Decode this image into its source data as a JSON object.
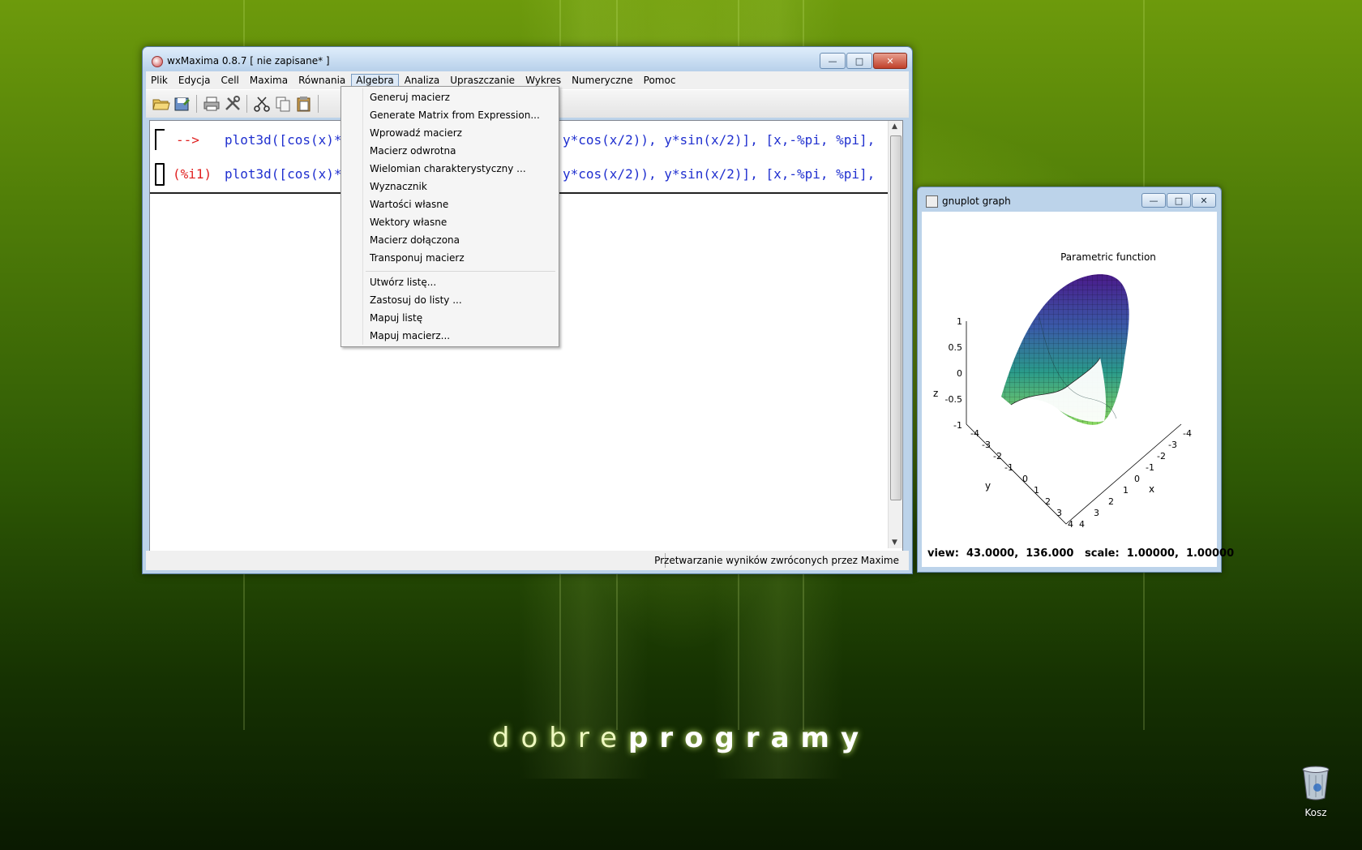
{
  "desktop": {
    "brand_light": "dobre",
    "brand_bold": "programy",
    "trash_label": "Kosz"
  },
  "wxmaxima": {
    "title": "wxMaxima 0.8.7 [ nie zapisane* ]",
    "menu": [
      "Plik",
      "Edycja",
      "Cell",
      "Maxima",
      "Równania",
      "Algebra",
      "Analiza",
      "Upraszczanie",
      "Wykres",
      "Numeryczne",
      "Pomoc"
    ],
    "active_menu": "Algebra",
    "cells": [
      {
        "prompt": "-->",
        "code_left": "plot3d([cos(x)*",
        "code_right": "y*cos(x/2)), y*sin(x/2)], [x,-%pi, %pi],"
      },
      {
        "prompt": "(%i1)",
        "code_left": "plot3d([cos(x)*",
        "code_right": "y*cos(x/2)), y*sin(x/2)], [x,-%pi, %pi],"
      }
    ],
    "status": "Przetwarzanie wyników zwróconych przez Maxime",
    "algebra_menu": {
      "group1": [
        "Generuj macierz",
        "Generate Matrix from Expression...",
        "Wprowadź macierz",
        "Macierz odwrotna",
        "Wielomian charakterystyczny ...",
        "Wyznacznik",
        "Wartości własne",
        "Wektory własne",
        "Macierz dołączona",
        "Transponuj macierz"
      ],
      "group2": [
        "Utwórz listę...",
        "Zastosuj do listy ...",
        "Mapuj listę",
        "Mapuj macierz..."
      ]
    }
  },
  "gnuplot": {
    "title": "gnuplot graph",
    "view_text": "view:  43.0000,  136.000   scale:  1.00000,  1.00000"
  },
  "chart_data": {
    "type": "surface3d",
    "title": "Parametric function",
    "xlabel": "x",
    "ylabel": "y",
    "zlabel": "z",
    "x_ticks": [
      "-4",
      "-3",
      "-2",
      "-1",
      "0",
      "1",
      "2",
      "3",
      "4"
    ],
    "y_ticks": [
      "-4",
      "-3",
      "-2",
      "-1",
      "0",
      "1",
      "2",
      "3",
      "4"
    ],
    "z_ticks": [
      "-1",
      "-0.5",
      "0",
      "0.5",
      "1"
    ],
    "surface": "Möbius strip, colored purple to green gradient"
  }
}
